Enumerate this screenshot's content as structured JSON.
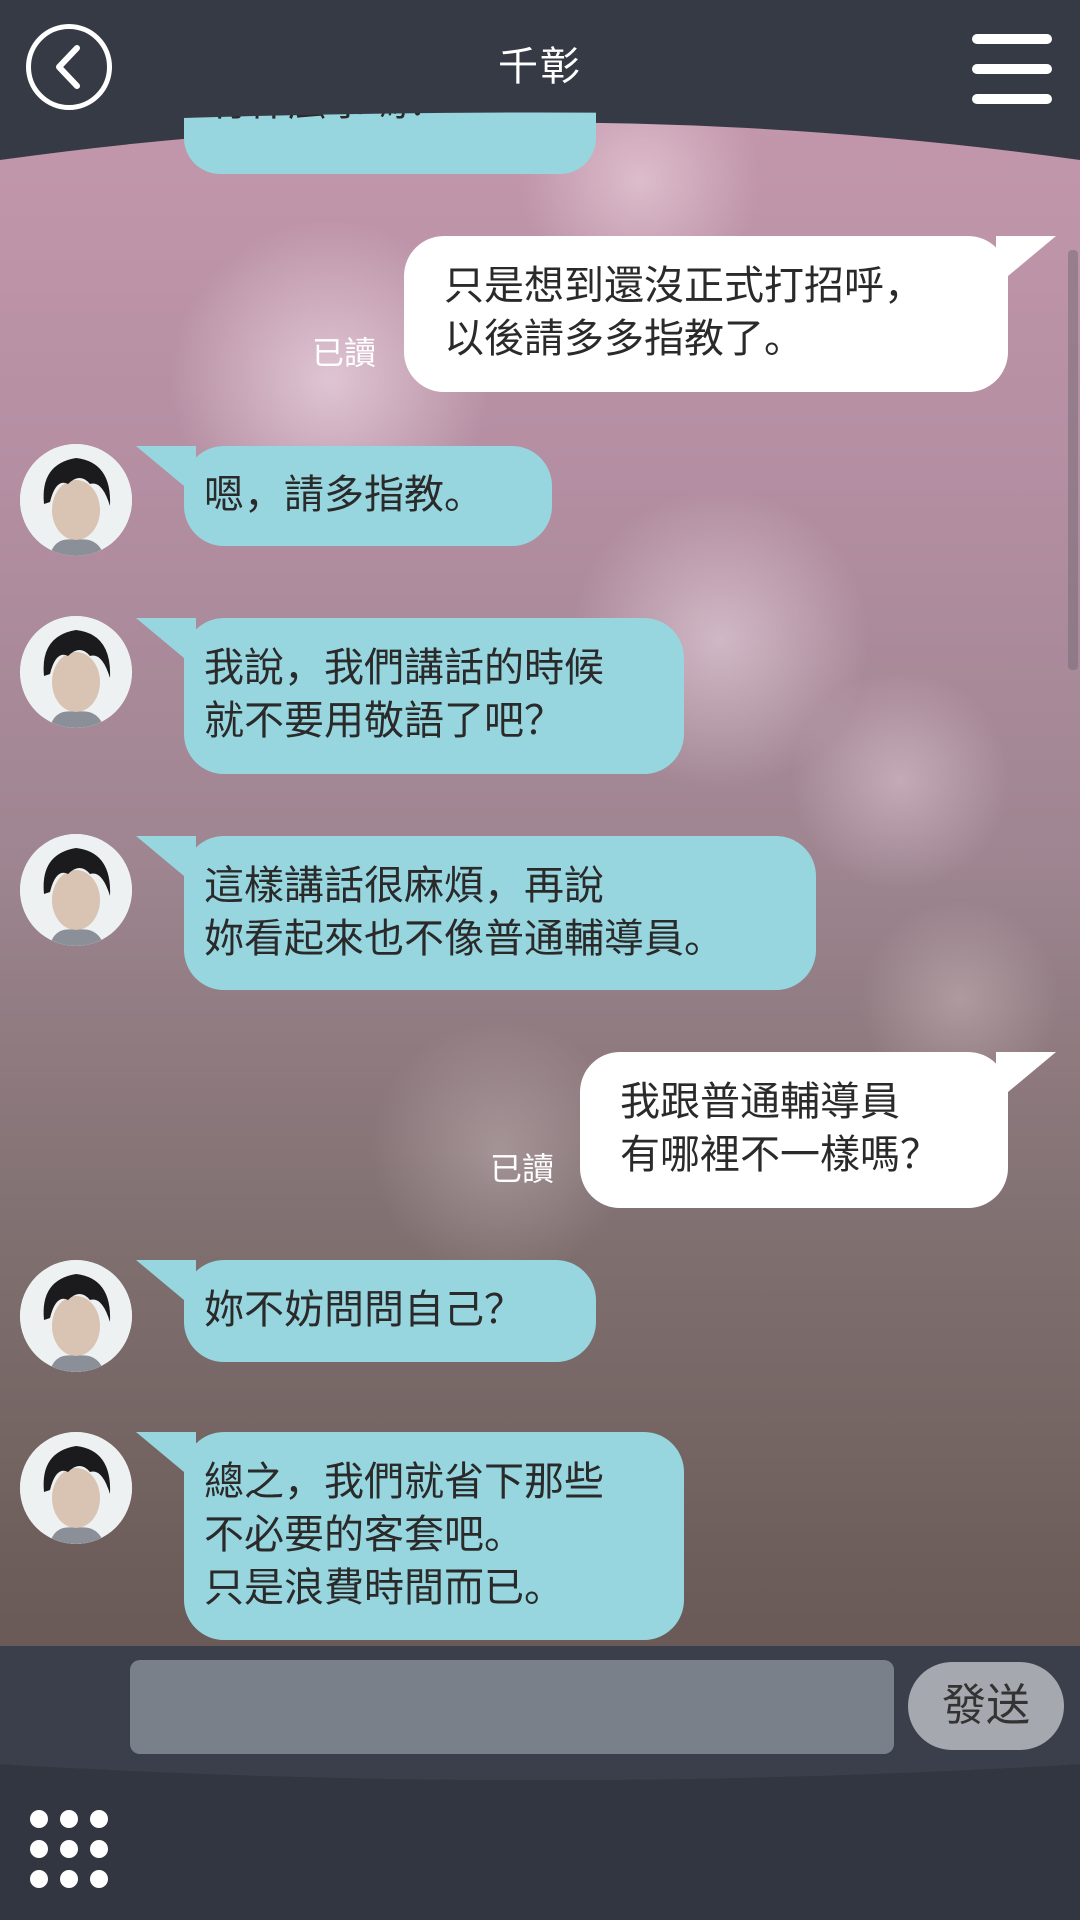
{
  "header": {
    "title": "千彰"
  },
  "chat": {
    "partial_top": "有什麼事嗎？",
    "messages": [
      {
        "side": "right",
        "text": "只是想到還沒正式打招呼，\n以後請多多指教了。",
        "status": "已讀"
      },
      {
        "side": "left",
        "text": "嗯，請多指教。"
      },
      {
        "side": "left",
        "text": "我說，我們講話的時候\n就不要用敬語了吧？"
      },
      {
        "side": "left",
        "text": "這樣講話很麻煩，再說\n妳看起來也不像普通輔導員。"
      },
      {
        "side": "right",
        "text": "我跟普通輔導員\n有哪裡不一樣嗎？",
        "status": "已讀"
      },
      {
        "side": "left",
        "text": "妳不妨問問自己？"
      },
      {
        "side": "left",
        "text": "總之，我們就省下那些\n不必要的客套吧。\n只是浪費時間而已。"
      }
    ]
  },
  "composer": {
    "send_label": "發送",
    "input_value": ""
  },
  "colors": {
    "left_bubble": "#98d6df",
    "right_bubble": "#ffffff",
    "bar": "#3a3f4b"
  },
  "icons": [
    "back-icon",
    "menu-icon",
    "grid-menu-icon"
  ]
}
